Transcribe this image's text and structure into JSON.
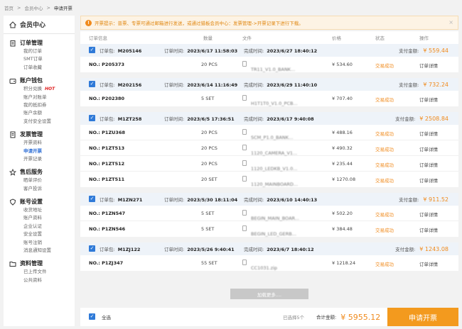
{
  "breadcrumb": {
    "home": "首页",
    "sep": ">",
    "level1": "会员中心",
    "current": "申请开票"
  },
  "sidebar": {
    "header": "会员中心",
    "groups": [
      {
        "title": "订单管理",
        "icon": "clipboard-icon",
        "items": [
          "我的订单",
          "SMT订单",
          "订单收藏"
        ]
      },
      {
        "title": "账户钱包",
        "icon": "wallet-icon",
        "items": [
          "积分兑换",
          "账户对账单",
          "我的抵扣券",
          "账户余额",
          "支付安全设置"
        ],
        "hot": "HOT"
      },
      {
        "title": "发票管理",
        "icon": "invoice-icon",
        "items": [
          "开票资料",
          "申请开票",
          "开票记录"
        ]
      },
      {
        "title": "售后服务",
        "icon": "service-icon",
        "items": [
          "晒单评价",
          "客户投诉"
        ]
      },
      {
        "title": "账号设置",
        "icon": "shield-icon",
        "items": [
          "收货地址",
          "账户资料",
          "企业认证",
          "安全设置",
          "账号注销",
          "消息通知设置"
        ]
      },
      {
        "title": "资料管理",
        "icon": "folder-icon",
        "items": [
          "已上传文件",
          "公共资料"
        ]
      }
    ]
  },
  "notice": {
    "text": "开票提示：普票、专票可通过邮箱进行发送，或通过猎板会员中心：发票管理->开票记录下进行下载。",
    "close": "×"
  },
  "table_header": {
    "info": "订单信息",
    "qty": "数量",
    "file": "文件",
    "price": "价格",
    "status": "状态",
    "op": "操作"
  },
  "labels": {
    "order_no": "订单包:",
    "order_time": "订单时间:",
    "done_time": "完成时间:",
    "pay": "支付金额:",
    "check": "✓"
  },
  "orders": [
    {
      "id": "M205146",
      "order_time": "2023/6/17 11:58:03",
      "done_time": "2023/6/27 18:40:12",
      "pay": "¥ 559.44",
      "rows": [
        {
          "no": "NO.: P205373",
          "qty": "20 PCS",
          "file": "TR11_V1.0_BANK...",
          "price": "¥ 534.60",
          "status": "交易成功",
          "op": "订单详情"
        }
      ]
    },
    {
      "id": "M202156",
      "order_time": "2023/6/14 11:16:49",
      "done_time": "2023/6/29 11:40:10",
      "pay": "¥ 732.24",
      "rows": [
        {
          "no": "NO.: P202380",
          "qty": "5 SET",
          "file": "H1T1T0_V1.0_PCB...",
          "price": "¥ 707.40",
          "status": "交易成功",
          "op": "订单详情"
        }
      ]
    },
    {
      "id": "M1ZT258",
      "order_time": "2023/6/5 17:36:51",
      "done_time": "2023/6/17 9:40:08",
      "pay": "¥ 2508.84",
      "rows": [
        {
          "no": "NO.: P1ZU368",
          "qty": "20 PCS",
          "file": "SCM_P1.0_BANK...",
          "price": "¥ 488.16",
          "status": "交易成功",
          "op": "订单详情"
        },
        {
          "no": "NO.: P1ZT513",
          "qty": "20 PCS",
          "file": "1120_CAMERA_V1...",
          "price": "¥ 490.32",
          "status": "交易成功",
          "op": "订单详情"
        },
        {
          "no": "NO.: P1ZT512",
          "qty": "20 PCS",
          "file": "1120_LEDKB_V1.0...",
          "price": "¥ 235.44",
          "status": "交易成功",
          "op": "订单详情"
        },
        {
          "no": "NO.: P1ZT511",
          "qty": "20 SET",
          "file": "1120_MAINBOARD...",
          "price": "¥ 1270.08",
          "status": "交易成功",
          "op": "订单详情"
        }
      ]
    },
    {
      "id": "M1ZN271",
      "order_time": "2023/5/30 18:11:04",
      "done_time": "2023/6/10 14:40:13",
      "pay": "¥ 911.52",
      "rows": [
        {
          "no": "NO.: P1ZN547",
          "qty": "5 SET",
          "file": "BEGIN_MAIN_BOAR...",
          "price": "¥ 502.20",
          "status": "交易成功",
          "op": "订单详情"
        },
        {
          "no": "NO.: P1ZN546",
          "qty": "5 SET",
          "file": "BEGIN_LED_GERB...",
          "price": "¥ 384.48",
          "status": "交易成功",
          "op": "订单详情"
        }
      ]
    },
    {
      "id": "M1ZJ122",
      "order_time": "2023/5/26 9:40:41",
      "done_time": "2023/6/7 18:40:12",
      "pay": "¥ 1243.08",
      "rows": [
        {
          "no": "NO.: P1ZJ347",
          "qty": "55 SET",
          "file": "CC1031.zip",
          "price": "¥ 1218.24",
          "status": "交易成功",
          "op": "订单详情"
        }
      ]
    }
  ],
  "load_more": "加载更多....",
  "footer": {
    "select_all": "全选",
    "selected": "已选择5个",
    "total_label": "合计金额:",
    "total": "¥ 5955.12",
    "apply": "申请开票"
  },
  "colors": {
    "accent": "#f39a1e",
    "checkbox": "#2f7ad8",
    "active_link": "#2f6fd6",
    "order_head": "#eef3f9"
  }
}
